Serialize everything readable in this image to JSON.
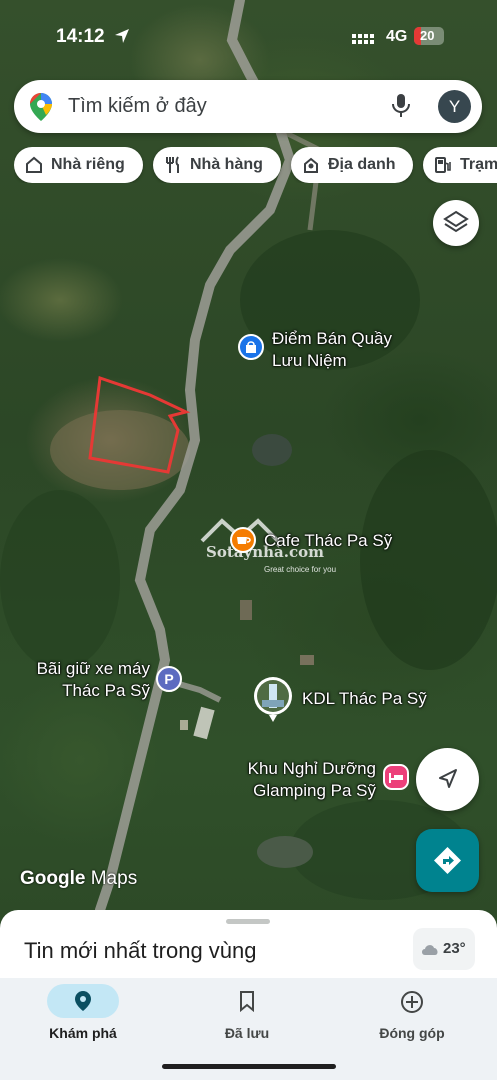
{
  "status_bar": {
    "time": "14:12",
    "network": "4G",
    "battery": "20"
  },
  "search": {
    "placeholder": "Tìm kiếm ở đây",
    "avatar_initial": "Y"
  },
  "chips": [
    {
      "label": "Nhà riêng",
      "icon": "home-icon"
    },
    {
      "label": "Nhà hàng",
      "icon": "restaurant-icon"
    },
    {
      "label": "Địa danh",
      "icon": "landmark-icon"
    },
    {
      "label": "Trạm",
      "icon": "gas-station-icon"
    }
  ],
  "map": {
    "places": [
      {
        "name_line1": "Điểm Bán Quầy",
        "name_line2": "Lưu Niệm",
        "icon": "shopping-bag-icon",
        "color": "#1a73e8"
      },
      {
        "name": "Cafe Thác Pa Sỹ",
        "icon": "cafe-icon",
        "color": "#f57c00"
      },
      {
        "name_line1": "Bãi giữ xe máy",
        "name_line2": "Thác Pa Sỹ",
        "icon": "parking-icon",
        "color": "#5c6bc0"
      },
      {
        "name": "KDL Thác Pa Sỹ",
        "icon": "waterfall-photo-icon",
        "color": "#ffffff"
      },
      {
        "name_line1": "Khu Nghỉ Dưỡng",
        "name_line2": "Glamping Pa Sỹ",
        "icon": "hotel-icon",
        "color": "#ec407a"
      }
    ],
    "parking_letter": "P",
    "watermark": {
      "name": "Sotaynhà.com",
      "tagline": "Great choice for you"
    },
    "attribution": {
      "brand": "Google",
      "product": "Maps"
    },
    "highlight_color": "#e53935"
  },
  "sheet": {
    "title": "Tin mới nhất trong vùng",
    "temperature": "23°"
  },
  "nav": [
    {
      "label": "Khám phá",
      "icon": "explore-pin-icon",
      "active": true
    },
    {
      "label": "Đã lưu",
      "icon": "bookmark-icon",
      "active": false
    },
    {
      "label": "Đóng góp",
      "icon": "add-circle-icon",
      "active": false
    }
  ],
  "colors": {
    "accent": "#00838f",
    "nav_active": "#c3e7f5"
  }
}
